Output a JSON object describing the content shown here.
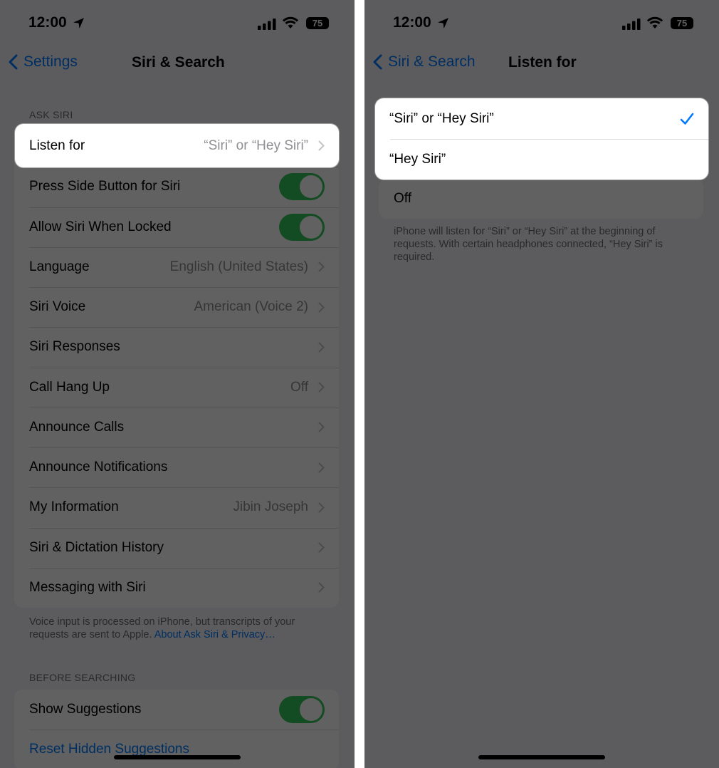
{
  "left": {
    "status": {
      "time": "12:00",
      "battery": "75"
    },
    "nav": {
      "back_label": "Settings",
      "title": "Siri & Search"
    },
    "ask_siri": {
      "header": "ASK SIRI",
      "listen_for": {
        "label": "Listen for",
        "value": "“Siri” or “Hey Siri”"
      },
      "rows": [
        {
          "label": "Press Side Button for Siri",
          "toggle": true
        },
        {
          "label": "Allow Siri When Locked",
          "toggle": true
        },
        {
          "label": "Language",
          "value": "English (United States)"
        },
        {
          "label": "Siri Voice",
          "value": "American (Voice 2)"
        },
        {
          "label": "Siri Responses",
          "value": ""
        },
        {
          "label": "Call Hang Up",
          "value": "Off"
        },
        {
          "label": "Announce Calls",
          "value": ""
        },
        {
          "label": "Announce Notifications",
          "value": ""
        },
        {
          "label": "My Information",
          "value": "Jibin Joseph"
        },
        {
          "label": "Siri & Dictation History",
          "value": ""
        },
        {
          "label": "Messaging with Siri",
          "value": ""
        }
      ],
      "footer_text": "Voice input is processed on iPhone, but transcripts of your requests are sent to Apple. ",
      "footer_link": "About Ask Siri & Privacy…"
    },
    "before_searching": {
      "header": "BEFORE SEARCHING",
      "show_suggestions": "Show Suggestions",
      "reset_hidden": "Reset Hidden Suggestions"
    }
  },
  "right": {
    "status": {
      "time": "12:00",
      "battery": "75"
    },
    "nav": {
      "back_label": "Siri & Search",
      "title": "Listen for"
    },
    "options": [
      {
        "label": "“Siri” or “Hey Siri”",
        "selected": true
      },
      {
        "label": "“Hey Siri”",
        "selected": false
      }
    ],
    "off_option": "Off",
    "footer": "iPhone will listen for “Siri” or “Hey Siri” at the beginning of requests. With certain headphones connected, “Hey Siri” is required."
  },
  "colors": {
    "accent": "#007aff",
    "toggle_on": "#34c759"
  }
}
